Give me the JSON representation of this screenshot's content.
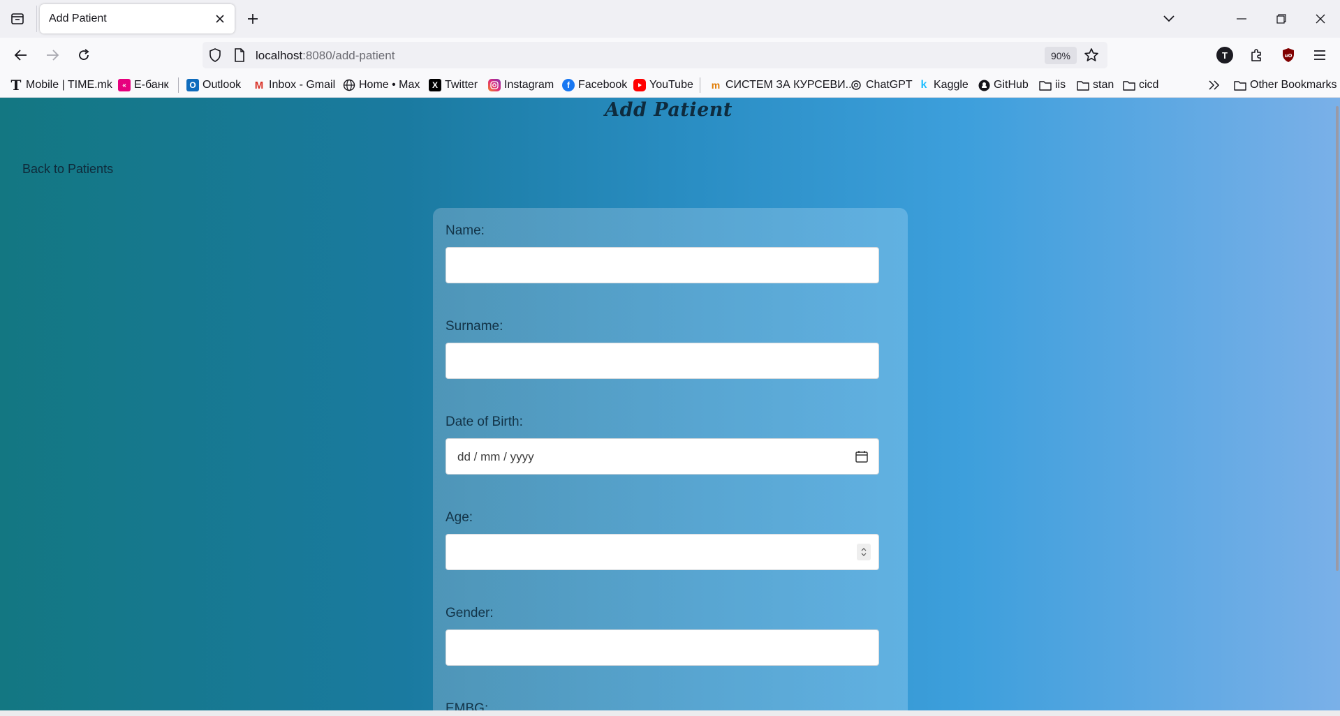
{
  "tab": {
    "title": "Add Patient"
  },
  "url": {
    "host": "localhost",
    "path": ":8080/add-patient",
    "zoom": "90%"
  },
  "bookmarks": [
    {
      "label": "Mobile | TIME.mk",
      "icon": "time-mk-icon"
    },
    {
      "label": "Е-банк",
      "icon": "ebank-icon"
    },
    {
      "label": "Outlook",
      "icon": "outlook-icon"
    },
    {
      "label": "Inbox - Gmail",
      "icon": "gmail-icon"
    },
    {
      "label": "Home • Max",
      "icon": "globe-icon"
    },
    {
      "label": "Twitter",
      "icon": "x-icon"
    },
    {
      "label": "Instagram",
      "icon": "instagram-icon"
    },
    {
      "label": "Facebook",
      "icon": "facebook-icon"
    },
    {
      "label": "YouTube",
      "icon": "youtube-icon"
    },
    {
      "label": "СИСТЕМ ЗА КУРСЕВИ...",
      "icon": "courses-icon"
    },
    {
      "label": "ChatGPT",
      "icon": "chatgpt-icon"
    },
    {
      "label": "Kaggle",
      "icon": "kaggle-icon"
    },
    {
      "label": "GitHub",
      "icon": "github-icon"
    },
    {
      "label": "iis",
      "icon": "folder-icon"
    },
    {
      "label": "stan",
      "icon": "folder-icon"
    },
    {
      "label": "cicd",
      "icon": "folder-icon"
    }
  ],
  "other_bookmarks": "Other Bookmarks",
  "extension_avatar": "T",
  "page": {
    "title": "Add Patient",
    "back_link": "Back to Patients",
    "fields": {
      "name": {
        "label": "Name:",
        "value": ""
      },
      "surname": {
        "label": "Surname:",
        "value": ""
      },
      "dob": {
        "label": "Date of Birth:",
        "placeholder": "dd / mm / yyyy"
      },
      "age": {
        "label": "Age:",
        "value": ""
      },
      "gender": {
        "label": "Gender:",
        "value": ""
      },
      "embg": {
        "label": "EMBG:"
      }
    }
  },
  "colors": {
    "gradient_start": "#137782",
    "gradient_end": "#7ab0e8",
    "title_text": "#0e2b3e"
  }
}
